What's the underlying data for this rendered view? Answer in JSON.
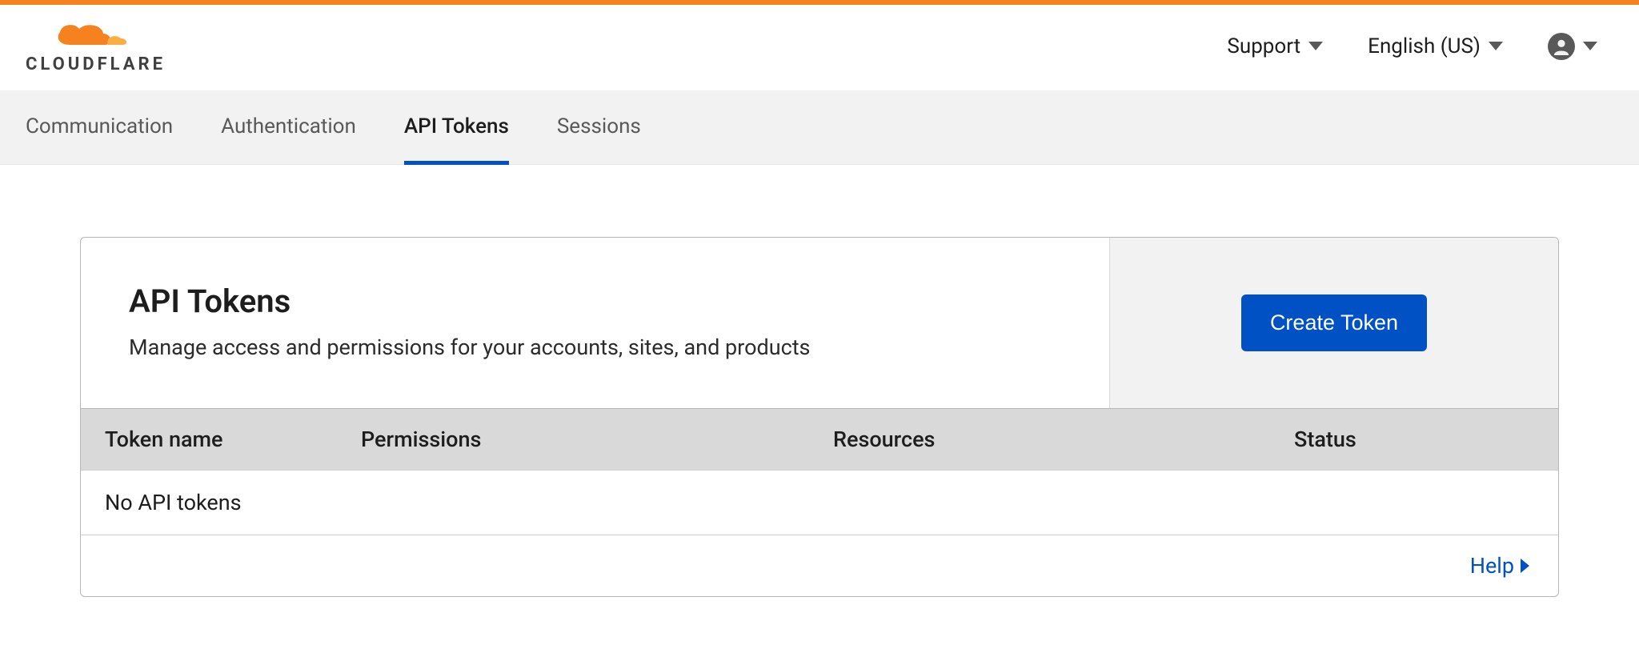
{
  "header": {
    "brand_text": "CLOUDFLARE",
    "support_label": "Support",
    "language_label": "English (US)"
  },
  "nav": {
    "tabs": [
      {
        "label": "Communication",
        "active": false
      },
      {
        "label": "Authentication",
        "active": false
      },
      {
        "label": "API Tokens",
        "active": true
      },
      {
        "label": "Sessions",
        "active": false
      }
    ]
  },
  "panel": {
    "title": "API Tokens",
    "subtitle": "Manage access and permissions for your accounts, sites, and products",
    "create_button": "Create Token"
  },
  "table": {
    "columns": {
      "token_name": "Token name",
      "permissions": "Permissions",
      "resources": "Resources",
      "status": "Status"
    },
    "empty_message": "No API tokens"
  },
  "footer": {
    "help_label": "Help"
  }
}
